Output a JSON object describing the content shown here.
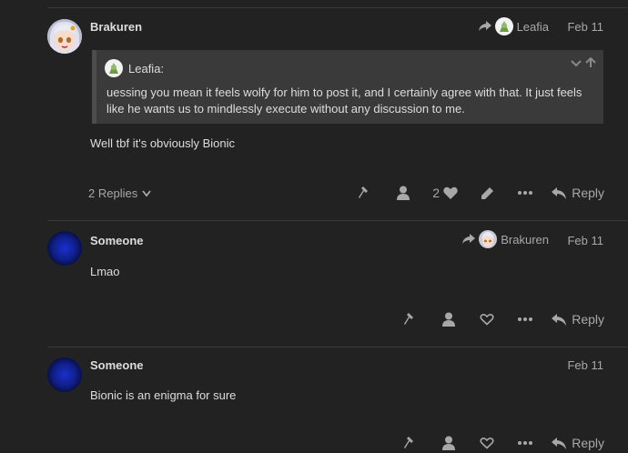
{
  "posts": [
    {
      "username": "Brakuren",
      "reply_to": "Leafia",
      "date": "Feb 11",
      "quote": {
        "author": "Leafia:",
        "text": "uessing you mean it feels wolfy for him to post it, and I certainly agree with that. It just feels like he wants us to mindlessly execute without any discussion to me."
      },
      "body": "Well tbf it's obviously Bionic",
      "replies_label": "2 Replies",
      "like_count": "2",
      "reply_label": "Reply"
    },
    {
      "username": "Someone",
      "reply_to": "Brakuren",
      "date": "Feb 11",
      "body": "Lmao",
      "reply_label": "Reply"
    },
    {
      "username": "Someone",
      "date": "Feb 11",
      "body": "Bionic is an enigma for sure",
      "reply_label": "Reply"
    }
  ]
}
